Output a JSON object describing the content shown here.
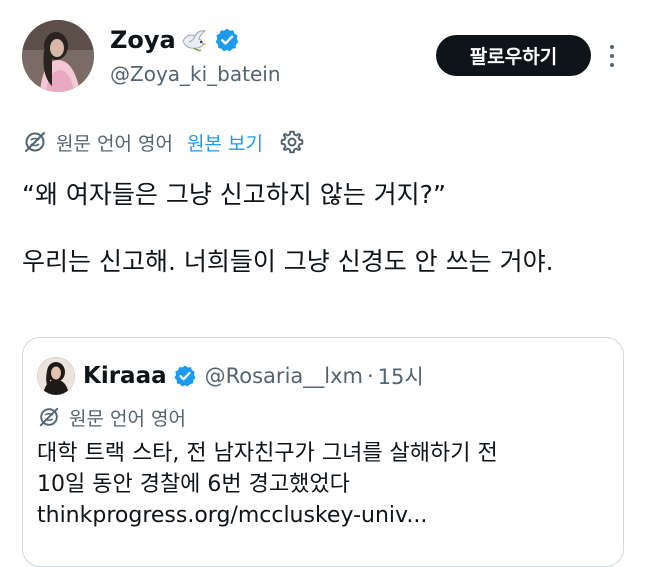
{
  "colors": {
    "text_primary": "#0f1419",
    "text_secondary": "#536471",
    "link_blue": "#1d9bf0",
    "verified_blue": "#1d9bf0",
    "border": "#cfd9de",
    "follow_button_bg": "#0f1419",
    "follow_button_text": "#ffffff"
  },
  "author": {
    "display_name": "Zoya",
    "name_emoji": "dove-emoji",
    "verified": true,
    "handle": "@Zoya_ki_batein",
    "avatar_icon": "avatar-photo"
  },
  "header": {
    "follow_label": "팔로우하기",
    "more_icon": "more-vertical-icon"
  },
  "translation": {
    "icon": "translate-icon",
    "language_label": "원문 언어 영어",
    "show_original_label": "원본 보기",
    "settings_icon": "settings-gear-icon"
  },
  "tweet": {
    "paragraphs": [
      "“왜 여자들은 그냥 신고하지 않는 거지?”",
      "우리는 신고해. 너희들이 그냥 신경도 안 쓰는 거야."
    ]
  },
  "quote": {
    "display_name": "Kiraaa",
    "verified": true,
    "handle": "@Rosaria__lxm",
    "separator": "·",
    "time": "15시",
    "avatar_icon": "avatar-photo",
    "translation_icon": "translate-icon",
    "translation_label": "원문 언어 영어",
    "lines": [
      "대학 트랙 스타, 전 남자친구가 그녀를 살해하기 전",
      "10일 동안 경찰에 6번 경고했었다",
      "thinkprogress.org/mccluskey-univ..."
    ]
  }
}
